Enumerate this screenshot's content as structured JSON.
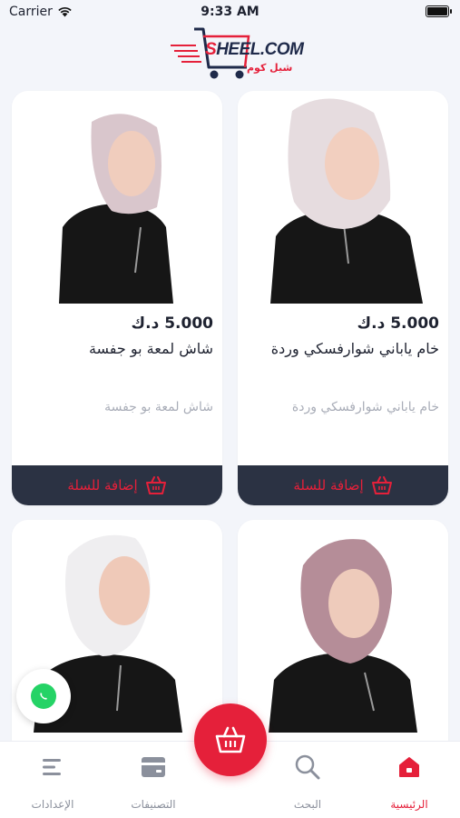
{
  "status_bar": {
    "carrier": "Carrier",
    "time": "9:33 AM"
  },
  "logo": {
    "brand_s": "S",
    "brand_rest": "HEEL.COM",
    "brand_arabic": "شيل كوم",
    "accent": "#e5203a"
  },
  "products": [
    {
      "price": "5.000 د.ك",
      "name": "خام ياباني شوارفسكي وردة",
      "description": "خام ياباني شوارفسكي وردة",
      "add_to_cart_label": "إضافة للسلة",
      "hijab_color": "#e6dcdf"
    },
    {
      "price": "5.000 د.ك",
      "name": "شاش لمعة بو جفسة",
      "description": "شاش لمعة  بو جفسة",
      "add_to_cart_label": "إضافة للسلة",
      "hijab_color": "#d9c6cc"
    },
    {
      "hijab_color": "#b58d98"
    },
    {
      "hijab_color": "#efeef0"
    }
  ],
  "tab_bar": {
    "home": "الرئيسية",
    "search": "البحث",
    "categories": "التصنيفات",
    "settings": "الإعدادات"
  },
  "colors": {
    "accent": "#e5203a",
    "button_dark": "#2b3243",
    "whatsapp": "#25d366"
  }
}
